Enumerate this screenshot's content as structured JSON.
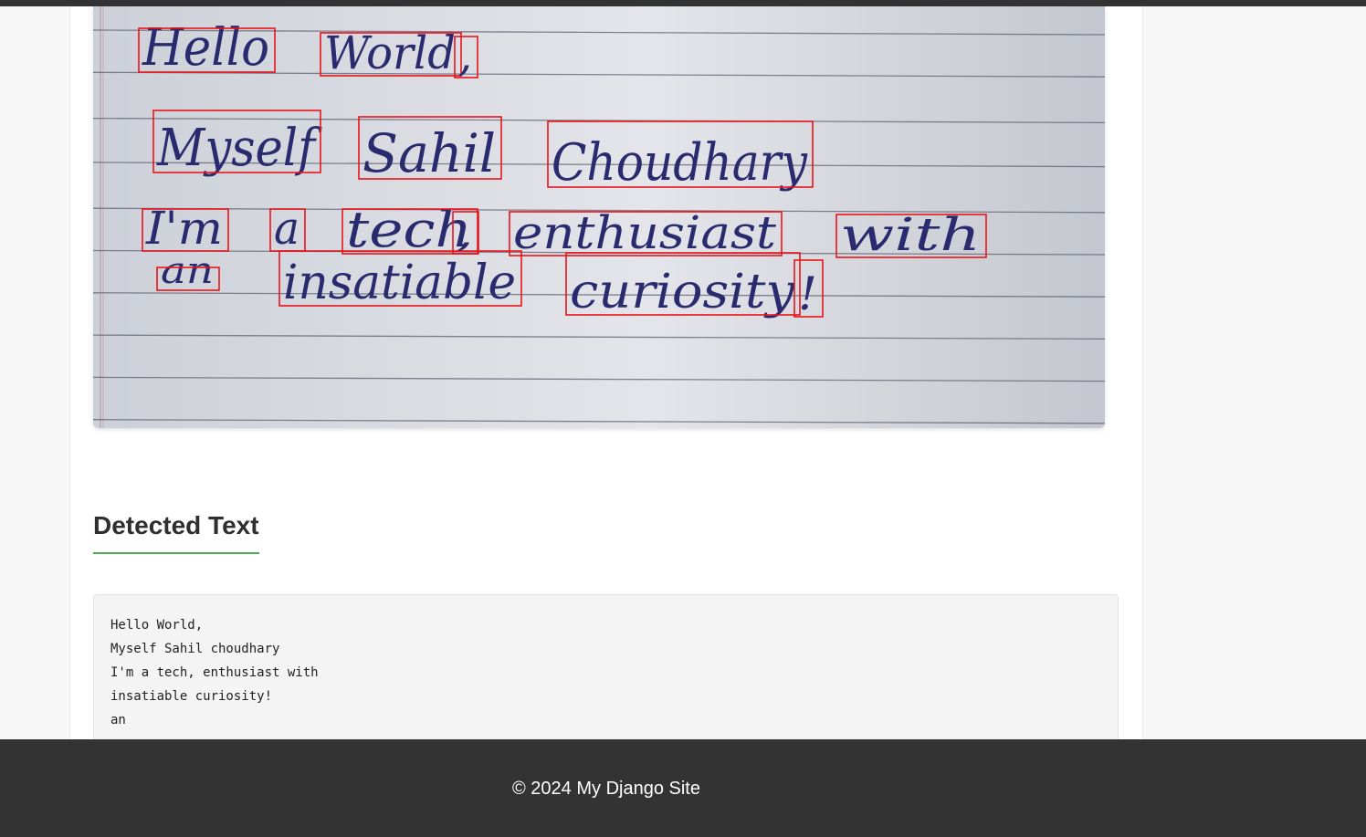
{
  "image": {
    "words": [
      {
        "text": "Hello",
        "size": 56
      },
      {
        "text": "World",
        "size": 50
      },
      {
        "text": ",",
        "size": 50
      },
      {
        "text": "Myself",
        "size": 56
      },
      {
        "text": "Sahil",
        "size": 58
      },
      {
        "text": "Choudhary",
        "size": 56
      },
      {
        "text": "I'm",
        "size": 50
      },
      {
        "text": "a",
        "size": 50
      },
      {
        "text": "tech",
        "size": 54
      },
      {
        "text": ",",
        "size": 40
      },
      {
        "text": "enthusiast",
        "size": 50
      },
      {
        "text": "with",
        "size": 50
      },
      {
        "text": "an",
        "size": 40
      },
      {
        "text": "insatiable",
        "size": 52
      },
      {
        "text": "curiosity",
        "size": 52
      },
      {
        "text": "!",
        "size": 50
      }
    ]
  },
  "section": {
    "title": "Detected Text"
  },
  "output": {
    "lines": [
      "Hello World,",
      "Myself Sahil choudhary",
      "I'm a tech, enthusiast with",
      "insatiable curiosity!",
      "an"
    ]
  },
  "footer": {
    "text": "© 2024 My Django Site"
  },
  "colors": {
    "paper": "#c9ccd4",
    "ink": "#2a2a6e",
    "box": "#e8141c",
    "accent": "#4caf50",
    "footer_bg": "#333333"
  }
}
